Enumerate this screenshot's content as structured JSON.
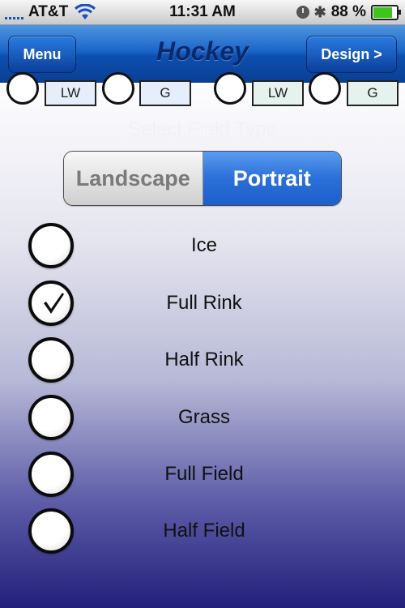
{
  "status": {
    "carrier": "AT&T",
    "time": "11:31 AM",
    "battery": "88 %",
    "battery_level": 0.88
  },
  "nav": {
    "menu_label": "Menu",
    "title": "Hockey",
    "design_label": "Design >"
  },
  "positions": [
    "LW",
    "G",
    "LW",
    "G"
  ],
  "field_type_label": "Select Field Type",
  "orientation": {
    "options": [
      "Landscape",
      "Portrait"
    ],
    "selected": "Portrait"
  },
  "field_options": [
    {
      "label": "Ice",
      "checked": false
    },
    {
      "label": "Full Rink",
      "checked": true
    },
    {
      "label": "Half Rink",
      "checked": false
    },
    {
      "label": "Grass",
      "checked": false
    },
    {
      "label": "Full Field",
      "checked": false
    },
    {
      "label": "Half Field",
      "checked": false
    }
  ],
  "colors": {
    "nav_blue": "#1c66c8",
    "segment_selected": "#2b6fd8",
    "battery_green": "#3ec41c"
  }
}
